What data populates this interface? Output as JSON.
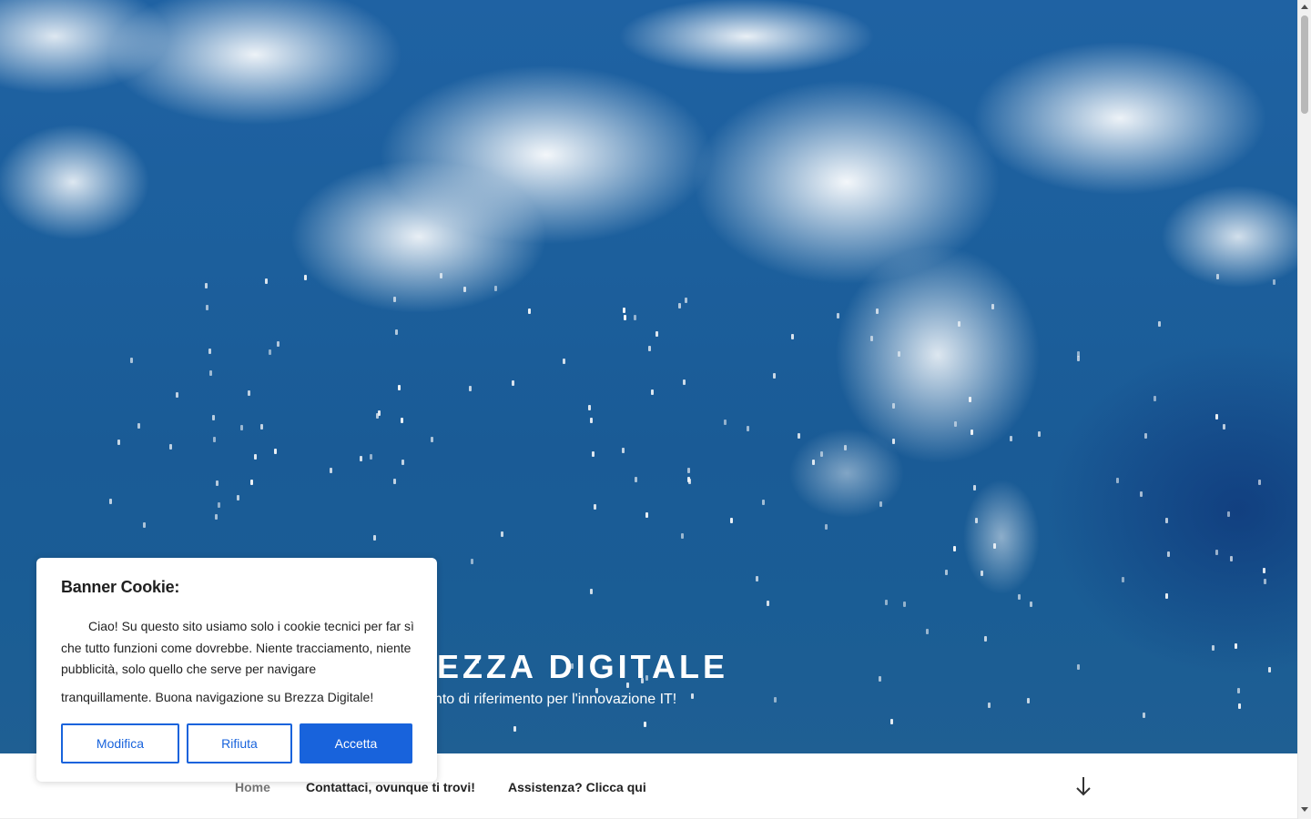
{
  "hero": {
    "site_title": "BREZZA DIGITALE",
    "site_description": "Il tuo punto di riferimento per l'innovazione IT!"
  },
  "nav": {
    "items": [
      {
        "label": "Home",
        "current": true
      },
      {
        "label": "Contattaci, ovunque ti trovi!"
      },
      {
        "label": "Assistenza? Clicca qui"
      }
    ],
    "scroll_icon": "arrow-down-icon"
  },
  "cookie_banner": {
    "title": "Banner Cookie:",
    "text_main": "Ciao! Su questo sito usiamo solo i cookie tecnici per far sì che tutto funzioni come dovrebbe. Niente tracciamento, niente pubblicità, solo quello che serve per navigare",
    "text_tail": "tranquillamente. Buona navigazione su Brezza Digitale!",
    "buttons": {
      "edit": "Modifica",
      "reject": "Rifiuta",
      "accept": "Accetta"
    },
    "accent_color": "#1863dc"
  }
}
